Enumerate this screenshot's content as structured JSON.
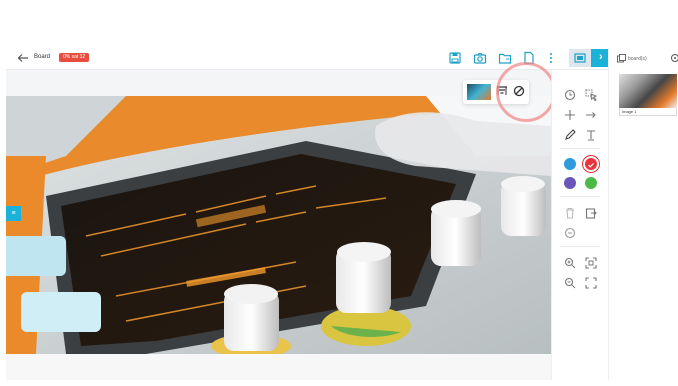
{
  "header": {
    "back_icon": "arrow-left-icon",
    "title": "Board",
    "badge": "0% sat 32",
    "badge_color": "#e74c3c",
    "accent_color": "#1ab2d8",
    "tools": [
      "save-icon",
      "camera-icon",
      "folder-icon",
      "file-icon",
      "more-icon"
    ]
  },
  "left_tab": {
    "label": "≡"
  },
  "floating_toolbar": {
    "icons": [
      "image-thumbnail",
      "filter-icon",
      "block-icon"
    ]
  },
  "side_tools": {
    "icons": [
      "clock-icon",
      "select-icon",
      "crosshair-icon",
      "arrow-right-icon",
      "pen-icon",
      "text-icon",
      "trash-icon",
      "export-icon",
      "history-icon",
      "zoom-in-icon",
      "fit-icon",
      "zoom-out-icon",
      "fullscreen-icon"
    ],
    "colors": [
      "#2e9bdc",
      "#e8333a",
      "#6a55b8",
      "#4cb848"
    ]
  },
  "boards_panel": {
    "title": "board(s)",
    "items": [
      {
        "label": "Image 1"
      }
    ]
  }
}
